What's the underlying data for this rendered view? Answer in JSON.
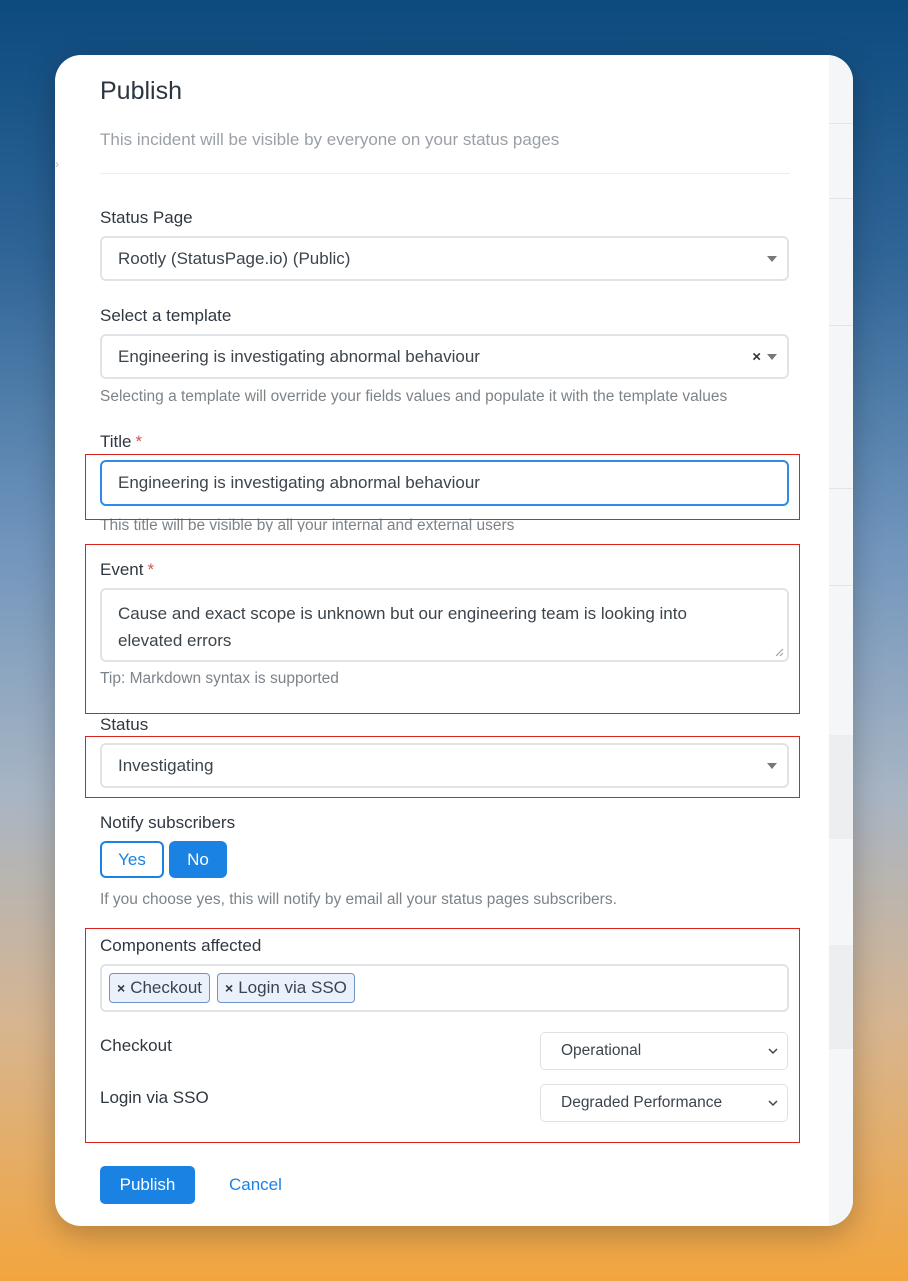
{
  "modal": {
    "title": "Publish",
    "subtitle": "This incident will be visible by everyone on your status pages"
  },
  "status_page": {
    "label": "Status Page",
    "value": "Rootly (StatusPage.io) (Public)"
  },
  "template": {
    "label": "Select a template",
    "value": "Engineering is investigating abnormal behaviour",
    "help": "Selecting a template will override your fields values and populate it with the template values"
  },
  "title_field": {
    "label": "Title",
    "required_mark": "*",
    "value": "Engineering is investigating abnormal behaviour",
    "help": "This title will be visible by all your internal and external users"
  },
  "event": {
    "label": "Event",
    "required_mark": "*",
    "value": "Cause and exact scope is unknown but our engineering team is looking into elevated errors",
    "help": "Tip: Markdown syntax is supported"
  },
  "status": {
    "label": "Status",
    "value": "Investigating"
  },
  "notify": {
    "label": "Notify subscribers",
    "yes_label": "Yes",
    "no_label": "No",
    "selected": "No",
    "help": "If you choose yes, this will notify by email all your status pages subscribers."
  },
  "components": {
    "label": "Components affected",
    "tags": [
      "Checkout",
      "Login via SSO"
    ],
    "rows": [
      {
        "name": "Checkout",
        "status": "Operational"
      },
      {
        "name": "Login via SSO",
        "status": "Degraded Performance"
      }
    ]
  },
  "actions": {
    "publish_label": "Publish",
    "cancel_label": "Cancel"
  },
  "colors": {
    "primary": "#1a82e2",
    "highlight_box": "#d9231c",
    "required": "#d9534f"
  },
  "icons": [
    "dropdown-caret-icon",
    "clear-icon",
    "resize-grip-icon",
    "remove-tag-icon",
    "chevron-down-icon"
  ]
}
